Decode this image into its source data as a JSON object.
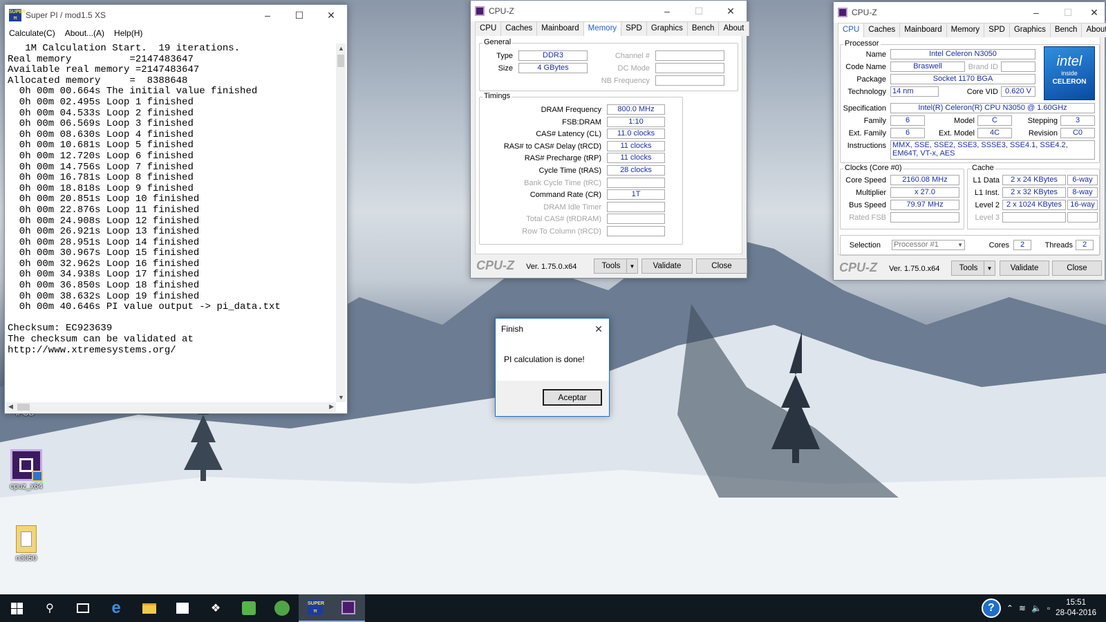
{
  "superpi": {
    "title": "Super PI / mod1.5 XS",
    "menu": [
      "Calculate(C)",
      "About...(A)",
      "Help(H)"
    ],
    "console_lines": [
      "   1M Calculation Start.  19 iterations.",
      "Real memory          =2147483647",
      "Available real memory =2147483647",
      "Allocated memory     =  8388648",
      "  0h 00m 00.664s The initial value finished",
      "  0h 00m 02.495s Loop 1 finished",
      "  0h 00m 04.533s Loop 2 finished",
      "  0h 00m 06.569s Loop 3 finished",
      "  0h 00m 08.630s Loop 4 finished",
      "  0h 00m 10.681s Loop 5 finished",
      "  0h 00m 12.720s Loop 6 finished",
      "  0h 00m 14.756s Loop 7 finished",
      "  0h 00m 16.781s Loop 8 finished",
      "  0h 00m 18.818s Loop 9 finished",
      "  0h 00m 20.851s Loop 10 finished",
      "  0h 00m 22.876s Loop 11 finished",
      "  0h 00m 24.908s Loop 12 finished",
      "  0h 00m 26.921s Loop 13 finished",
      "  0h 00m 28.951s Loop 14 finished",
      "  0h 00m 30.967s Loop 15 finished",
      "  0h 00m 32.962s Loop 16 finished",
      "  0h 00m 34.938s Loop 17 finished",
      "  0h 00m 36.850s Loop 18 finished",
      "  0h 00m 38.632s Loop 19 finished",
      "  0h 00m 40.646s PI value output -> pi_data.txt",
      "",
      "Checksum: EC923639",
      "The checksum can be validated at",
      "http://www.xtremesystems.org/"
    ]
  },
  "cpuz_mem": {
    "title": "CPU-Z",
    "tabs": [
      "CPU",
      "Caches",
      "Mainboard",
      "Memory",
      "SPD",
      "Graphics",
      "Bench",
      "About"
    ],
    "active_tab": "Memory",
    "general_label": "General",
    "type_label": "Type",
    "type": "DDR3",
    "size_label": "Size",
    "size": "4 GBytes",
    "channel_label": "Channel #",
    "channel": "",
    "dcmode_label": "DC Mode",
    "dcmode": "",
    "nbfreq_label": "NB Frequency",
    "nbfreq": "",
    "timings_label": "Timings",
    "timings": [
      {
        "label": "DRAM Frequency",
        "value": "800.0 MHz",
        "dim": false
      },
      {
        "label": "FSB:DRAM",
        "value": "1:10",
        "dim": false
      },
      {
        "label": "CAS# Latency (CL)",
        "value": "11.0 clocks",
        "dim": false
      },
      {
        "label": "RAS# to CAS# Delay (tRCD)",
        "value": "11 clocks",
        "dim": false
      },
      {
        "label": "RAS# Precharge (tRP)",
        "value": "11 clocks",
        "dim": false
      },
      {
        "label": "Cycle Time (tRAS)",
        "value": "28 clocks",
        "dim": false
      },
      {
        "label": "Bank Cycle Time (tRC)",
        "value": "",
        "dim": true
      },
      {
        "label": "Command Rate (CR)",
        "value": "1T",
        "dim": false
      },
      {
        "label": "DRAM Idle Timer",
        "value": "",
        "dim": true
      },
      {
        "label": "Total CAS# (tRDRAM)",
        "value": "",
        "dim": true
      },
      {
        "label": "Row To Column (tRCD)",
        "value": "",
        "dim": true
      }
    ],
    "logo": "CPU-Z",
    "version": "Ver. 1.75.0.x64",
    "tools": "Tools",
    "validate": "Validate",
    "close": "Close"
  },
  "cpuz_cpu": {
    "title": "CPU-Z",
    "tabs": [
      "CPU",
      "Caches",
      "Mainboard",
      "Memory",
      "SPD",
      "Graphics",
      "Bench",
      "About"
    ],
    "active_tab": "CPU",
    "processor_label": "Processor",
    "name_label": "Name",
    "name": "Intel Celeron N3050",
    "codename_label": "Code Name",
    "codename": "Braswell",
    "brandid_label": "Brand ID",
    "brandid": "",
    "package_label": "Package",
    "package": "Socket 1170 BGA",
    "tech_label": "Technology",
    "tech": "14 nm",
    "corevid_label": "Core VID",
    "corevid": "0.620 V",
    "spec_label": "Specification",
    "spec": "Intel(R) Celeron(R) CPU  N3050  @ 1.60GHz",
    "family_label": "Family",
    "family": "6",
    "model_label": "Model",
    "model": "C",
    "stepping_label": "Stepping",
    "stepping": "3",
    "extfamily_label": "Ext. Family",
    "extfamily": "6",
    "extmodel_label": "Ext. Model",
    "extmodel": "4C",
    "revision_label": "Revision",
    "revision": "C0",
    "instr_label": "Instructions",
    "instr": "MMX, SSE, SSE2, SSE3, SSSE3, SSE4.1, SSE4.2, EM64T, VT-x, AES",
    "intel_logo": {
      "brand": "intel",
      "inside": "inside",
      "product": "CELERON"
    },
    "clocks_label": "Clocks (Core #0)",
    "corespeed_label": "Core Speed",
    "corespeed": "2160.08 MHz",
    "multiplier_label": "Multiplier",
    "multiplier": "x 27.0",
    "busspeed_label": "Bus Speed",
    "busspeed": "79.97 MHz",
    "ratedfsb_label": "Rated FSB",
    "ratedfsb": "",
    "cache_label": "Cache",
    "l1d_label": "L1 Data",
    "l1d": "2 x 24 KBytes",
    "l1d_way": "6-way",
    "l1i_label": "L1 Inst.",
    "l1i": "2 x 32 KBytes",
    "l1i_way": "8-way",
    "l2_label": "Level 2",
    "l2": "2 x 1024 KBytes",
    "l2_way": "16-way",
    "l3_label": "Level 3",
    "l3": "",
    "l3_way": "",
    "selection_label": "Selection",
    "selection": "Processor #1",
    "cores_label": "Cores",
    "cores": "2",
    "threads_label": "Threads",
    "threads": "2",
    "logo": "CPU-Z",
    "version": "Ver. 1.75.0.x64",
    "tools": "Tools",
    "validate": "Validate",
    "close": "Close"
  },
  "dialog": {
    "title": "Finish",
    "message": "PI calculation is done!",
    "ok": "Aceptar"
  },
  "desktop_icons": [
    {
      "label": "iPOS"
    },
    {
      "label": "cpuz_x64"
    },
    {
      "label": "n3050"
    }
  ],
  "taskbar": {
    "clock_time": "15:51",
    "clock_date": "28-04-2016",
    "superpi_label": "SUPER"
  }
}
